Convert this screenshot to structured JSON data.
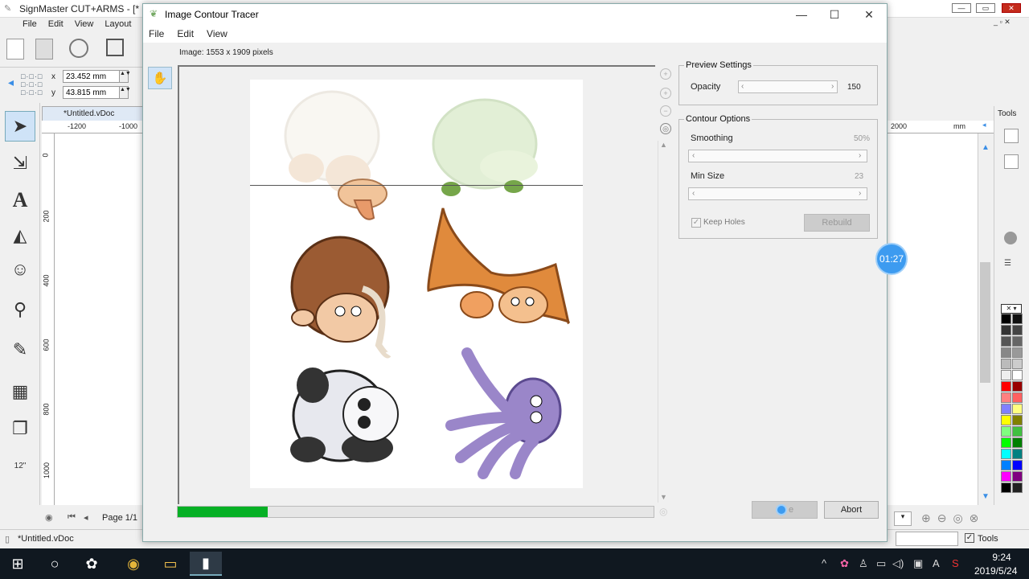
{
  "app": {
    "title": "SignMaster CUT+ARMS - [*",
    "menu": [
      "File",
      "Edit",
      "View",
      "Layout"
    ],
    "x_label": "x",
    "y_label": "y",
    "x_value": "23.452 mm",
    "y_value": "43.815 mm",
    "doc_tab": "*Untitled.vDoc",
    "ruler_h": [
      "-1200",
      "-1000"
    ],
    "ruler_v": [
      "0",
      "200",
      "400",
      "600",
      "800",
      "1000"
    ],
    "ruler_unit": "mm",
    "ruler_right": [
      "2000"
    ],
    "page_label": "Page 1/1",
    "status_doc": "*Untitled.vDoc",
    "tools_label": "Tools",
    "tools_checkbox": "Tools"
  },
  "dialog": {
    "title": "Image Contour Tracer",
    "menu": [
      "File",
      "Edit",
      "View"
    ],
    "image_info": "Image: 1553 x 1909 pixels",
    "preview_settings": {
      "legend": "Preview Settings",
      "opacity_label": "Opacity",
      "opacity_value": "150"
    },
    "contour_options": {
      "legend": "Contour Options",
      "smoothing_label": "Smoothing",
      "smoothing_value": "50%",
      "minsize_label": "Min Size",
      "minsize_value": "23",
      "keep_holes_label": "Keep Holes",
      "keep_holes_checked": true,
      "rebuild_label": "Rebuild"
    },
    "progress": 0.19,
    "done_label": "e",
    "abort_label": "Abort"
  },
  "timer": "01:27",
  "taskbar": {
    "time": "9:24",
    "date": "2019/5/24"
  },
  "colors": {
    "progress_green": "#06b025",
    "timer_blue": "#3d9bf0"
  }
}
